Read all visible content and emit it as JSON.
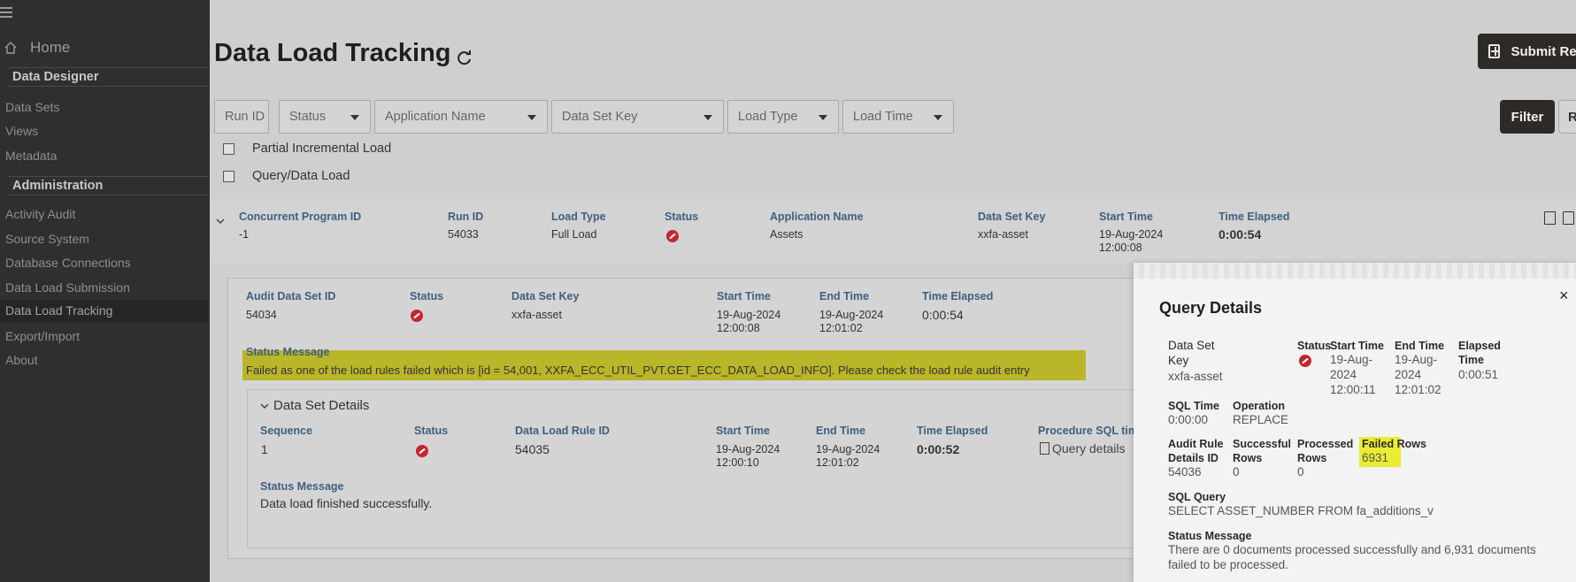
{
  "sidebar": {
    "home": "Home",
    "sections": [
      {
        "title": "Data Designer",
        "items": [
          "Data Sets",
          "Views",
          "Metadata"
        ]
      },
      {
        "title": "Administration",
        "items": [
          "Activity Audit",
          "Source System",
          "Database Connections",
          "Data Load Submission",
          "Data Load Tracking",
          "Export/Import",
          "About"
        ]
      }
    ],
    "active_item": "Data Load Tracking"
  },
  "header": {
    "title": "Data Load Tracking",
    "submit_label": "Submit Rec"
  },
  "filters": {
    "run_id_placeholder": "Run ID",
    "status": "Status",
    "application_name": "Application Name",
    "data_set_key": "Data Set Key",
    "load_type": "Load Type",
    "load_time": "Load Time",
    "filter_button": "Filter",
    "second_button": "R"
  },
  "checkboxes": {
    "partial": "Partial Incremental Load",
    "query": "Query/Data Load"
  },
  "summary": {
    "headers": [
      "Concurrent Program ID",
      "Run ID",
      "Load Type",
      "Status",
      "Application Name",
      "Data Set Key",
      "Start Time",
      "Time Elapsed"
    ],
    "values": {
      "program_id": "-1",
      "run_id": "54033",
      "load_type": "Full Load",
      "application_name": "Assets",
      "data_set_key": "xxfa-asset",
      "start_time_1": "19-Aug-2024",
      "start_time_2": "12:00:08",
      "time_elapsed": "0:00:54"
    }
  },
  "audit": {
    "headers": [
      "Audit Data Set ID",
      "Status",
      "Data Set Key",
      "Start Time",
      "End Time",
      "Time Elapsed"
    ],
    "values": {
      "id": "54034",
      "data_set_key": "xxfa-asset",
      "start_1": "19-Aug-2024",
      "start_2": "12:00:08",
      "end_1": "19-Aug-2024",
      "end_2": "12:01:02",
      "elapsed": "0:00:54"
    },
    "status_message_label": "Status Message",
    "status_message": "Failed as one of the load rules failed which is [id = 54,001, XXFA_ECC_UTIL_PVT.GET_ECC_DATA_LOAD_INFO]. Please check the load rule audit entry"
  },
  "data_set_details": {
    "title": "Data Set Details",
    "headers": [
      "Sequence",
      "Status",
      "Data Load Rule ID",
      "Start Time",
      "End Time",
      "Time Elapsed",
      "Procedure SQL tim"
    ],
    "values": {
      "sequence": "1",
      "rule_id": "54035",
      "start_1": "19-Aug-2024",
      "start_2": "12:00:10",
      "end_1": "19-Aug-2024",
      "end_2": "12:01:02",
      "elapsed": "0:00:52",
      "query_details": "Query details"
    },
    "status_message_label": "Status Message",
    "status_message": "Data load finished successfully."
  },
  "popup": {
    "title": "Query Details",
    "close": "×",
    "data_set_key_label_1": "Data Set",
    "data_set_key_label_2": "Key",
    "data_set_key": "xxfa-asset",
    "status_label": "Status",
    "start_label": "Start Time",
    "start_1": "19-Aug-",
    "start_2": "2024",
    "start_3": "12:00:11",
    "end_label": "End Time",
    "end_1": "19-Aug-",
    "end_2": "2024",
    "end_3": "12:01:02",
    "elapsed_label_1": "Elapsed",
    "elapsed_label_2": "Time",
    "elapsed": "0:00:51",
    "sql_time_label": "SQL Time",
    "sql_time": "0:00:00",
    "operation_label": "Operation",
    "operation": "REPLACE",
    "audit_rule_label_1": "Audit Rule",
    "audit_rule_label_2": "Details ID",
    "audit_rule_id": "54036",
    "successful_label_1": "Successful",
    "successful_label_2": "Rows",
    "successful": "0",
    "processed_label_1": "Processed",
    "processed_label_2": "Rows",
    "processed": "0",
    "failed_label": "Failed Rows",
    "failed": "6931",
    "sql_query_label": "SQL Query",
    "sql_query": "SELECT ASSET_NUMBER FROM fa_additions_v",
    "status_message_label": "Status Message",
    "status_message_1": "There are 0 documents processed successfully and 6,931 documents",
    "status_message_2": "failed to be processed."
  },
  "colors": {
    "sidebar_bg": "#2f2f2f",
    "header_blue": "#3f5f80",
    "error_red": "#c4262e",
    "highlight": "#e8e800"
  }
}
